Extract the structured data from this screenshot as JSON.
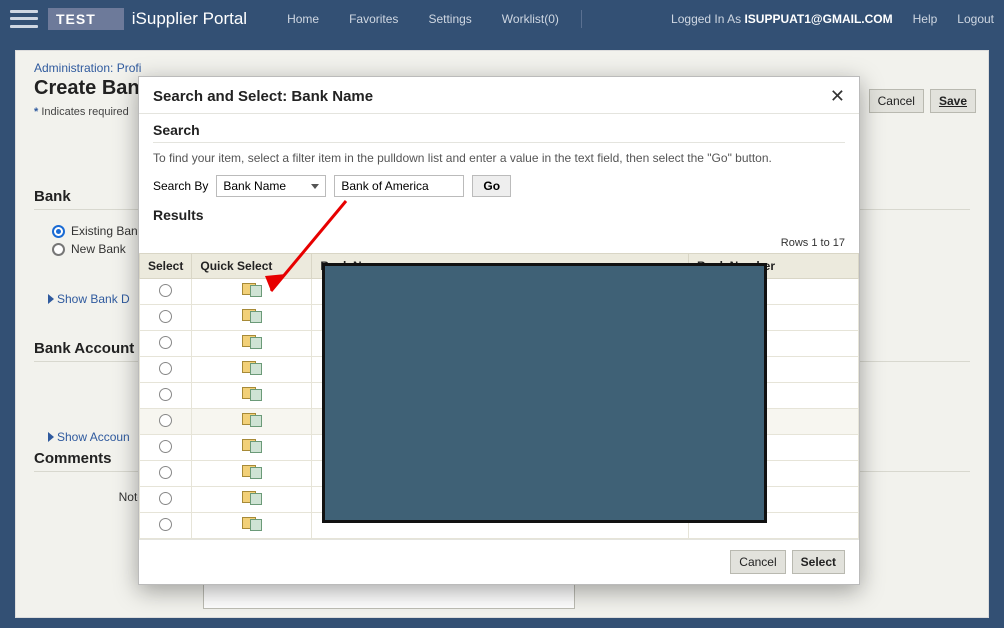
{
  "nav": {
    "test_badge": "TEST",
    "portal": "iSupplier Portal",
    "links": {
      "home": "Home",
      "favorites": "Favorites",
      "settings": "Settings",
      "worklist": "Worklist(0)"
    },
    "logged_prefix": "Logged In As ",
    "logged_user": "ISUPPUAT1@GMAIL.COM",
    "help": "Help",
    "logout": "Logout"
  },
  "page": {
    "breadcrumb": "Administration: Profi",
    "title": "Create Bank",
    "required": "Indicates required",
    "cancel": "Cancel",
    "save": "Save",
    "bank_header": "Bank",
    "existing_bank": "Existing Ban",
    "new_bank": "New Bank",
    "show_bank": "Show Bank D",
    "bank_account_header": "Bank Account",
    "show_account": "Show Accoun",
    "comments_header": "Comments",
    "note_label": "Note"
  },
  "modal": {
    "title": "Search and Select: Bank Name",
    "search_header": "Search",
    "hint": "To find your item, select a filter item in the pulldown list and enter a value in the text field, then select the \"Go\" button.",
    "search_by_label": "Search By",
    "search_by_value": "Bank Name",
    "search_value": "Bank of America",
    "go": "Go",
    "results_header": "Results",
    "rows_indicator": "Rows 1 to 17",
    "col_select": "Select",
    "col_quick": "Quick Select",
    "col_bankname": "Bank Name",
    "col_banknum": "Bank Number",
    "cancel": "Cancel",
    "select": "Select",
    "row_count": 10
  }
}
